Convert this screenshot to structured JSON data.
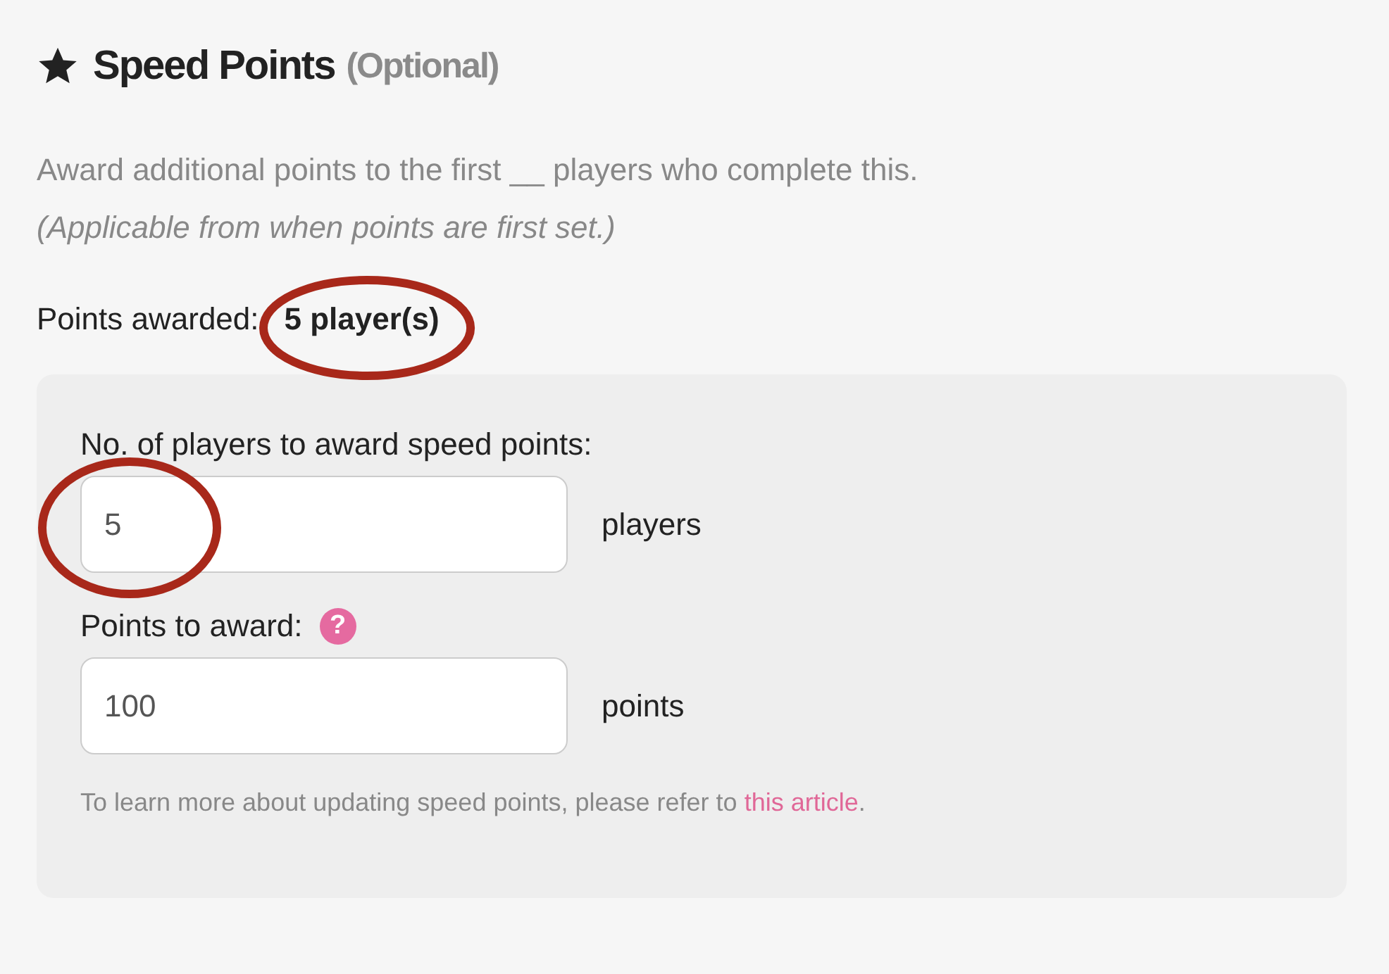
{
  "heading": {
    "title": "Speed Points",
    "note": "(Optional)"
  },
  "description": "Award additional points to the first __ players who complete this.",
  "description_note": "(Applicable from when points are first set.)",
  "summary": {
    "label": "Points awarded:",
    "value": "5 player(s)",
    "highlighted": true
  },
  "fields": [
    {
      "label": "No. of players to award speed points:",
      "value": "5",
      "suffix": "players",
      "highlighted": true
    },
    {
      "label": "Points to award:",
      "help": "?",
      "value": "100",
      "suffix": "points",
      "highlighted": false
    }
  ],
  "footer": {
    "text": "To learn more about updating speed points, please refer to ",
    "link": "this article",
    "end": "."
  }
}
